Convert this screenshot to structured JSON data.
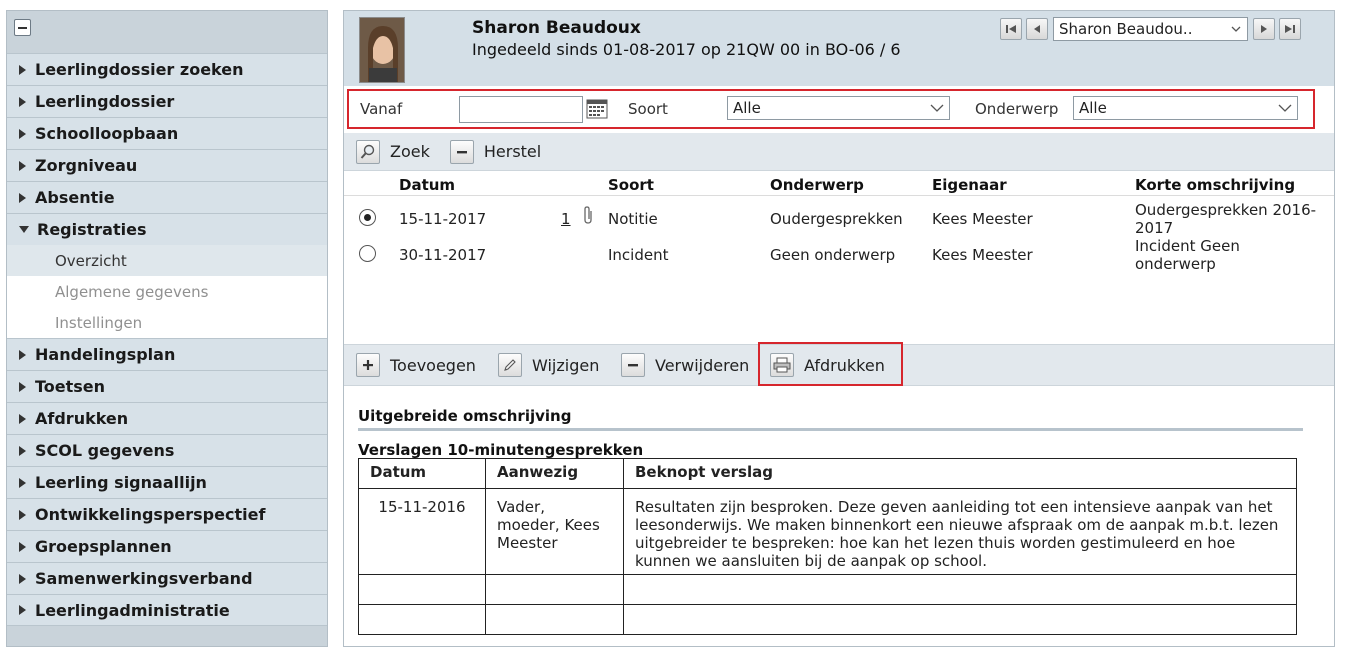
{
  "sidebar": {
    "items": [
      {
        "label": "Leerlingdossier zoeken"
      },
      {
        "label": "Leerlingdossier"
      },
      {
        "label": "Schoolloopbaan"
      },
      {
        "label": "Zorgniveau"
      },
      {
        "label": "Absentie"
      },
      {
        "label": "Registraties"
      },
      {
        "label": "Handelingsplan"
      },
      {
        "label": "Toetsen"
      },
      {
        "label": "Afdrukken"
      },
      {
        "label": "SCOL gegevens"
      },
      {
        "label": "Leerling signaallijn"
      },
      {
        "label": "Ontwikkelingsperspectief"
      },
      {
        "label": "Groepsplannen"
      },
      {
        "label": "Samenwerkingsverband"
      },
      {
        "label": "Leerlingadministratie"
      }
    ],
    "subitems": [
      {
        "label": "Overzicht"
      },
      {
        "label": "Algemene gegevens"
      },
      {
        "label": "Instellingen"
      }
    ]
  },
  "student": {
    "name": "Sharon Beaudoux",
    "info": "Ingedeeld sinds 01-08-2017 op 21QW 00 in BO-06 / 6",
    "selector_value": "Sharon Beaudou.."
  },
  "filter": {
    "vanaf_label": "Vanaf",
    "vanaf_value": "",
    "soort_label": "Soort",
    "soort_value": "Alle",
    "onderwerp_label": "Onderwerp",
    "onderwerp_value": "Alle"
  },
  "toolbar1": {
    "zoek": "Zoek",
    "herstel": "Herstel"
  },
  "grid": {
    "headers": {
      "datum": "Datum",
      "soort": "Soort",
      "onderwerp": "Onderwerp",
      "eigenaar": "Eigenaar",
      "korte": "Korte omschrijving"
    },
    "rows": [
      {
        "datum": "15-11-2017",
        "bijlagen": "1",
        "soort": "Notitie",
        "onderwerp": "Oudergesprekken",
        "eigenaar": "Kees Meester",
        "korte": "Oudergesprekken 2016-2017"
      },
      {
        "datum": "30-11-2017",
        "bijlagen": "",
        "soort": "Incident",
        "onderwerp": "Geen onderwerp",
        "eigenaar": "Kees Meester",
        "korte": "Incident Geen onderwerp"
      }
    ]
  },
  "toolbar2": {
    "toevoegen": "Toevoegen",
    "wijzigen": "Wijzigen",
    "verwijderen": "Verwijderen",
    "afdrukken": "Afdrukken"
  },
  "detail": {
    "title": "Uitgebreide omschrijving",
    "subtitle": "Verslagen 10-minutengesprekken",
    "table": {
      "headers": {
        "datum": "Datum",
        "aanwezig": "Aanwezig",
        "verslag": "Beknopt verslag"
      },
      "rows": [
        {
          "datum": "15-11-2016",
          "aanwezig": "Vader, moeder, Kees Meester",
          "verslag": "Resultaten zijn besproken. Deze geven aanleiding tot een intensieve aanpak van het leesonderwijs. We maken binnenkort een nieuwe afspraak om de aanpak m.b.t. lezen uitgebreider te bespreken: hoe kan het lezen thuis worden gestimuleerd en hoe kunnen we aansluiten bij de aanpak op school."
        }
      ]
    }
  },
  "colors": {
    "highlight": "#d6262d",
    "sidebar_bg": "#c9d3da",
    "header_bg": "#d4dfe7"
  }
}
